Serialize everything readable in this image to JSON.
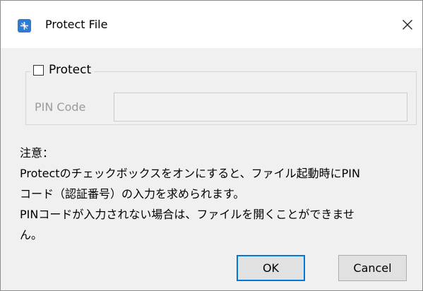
{
  "window": {
    "title": "Protect File",
    "icon": "app-icon",
    "close_symbol": "✕"
  },
  "protect": {
    "checkbox_label": "Protect",
    "checked": false
  },
  "pin": {
    "label": "PIN Code",
    "value": ""
  },
  "notes": {
    "heading": "注意：",
    "lines": [
      "Protectのチェックボックスをオンにすると、ファイル起動時にPIN",
      "コード（認証番号）の入力を求められます。",
      "PINコードが入力されない場合は、ファイルを開くことができませ",
      "ん。"
    ]
  },
  "buttons": {
    "ok": "OK",
    "cancel": "Cancel"
  },
  "colors": {
    "accent": "#0078d7",
    "dialog_bg": "#f0f0f0",
    "icon_bg": "#2d7bd4",
    "disabled_text": "#9b9b9b"
  }
}
